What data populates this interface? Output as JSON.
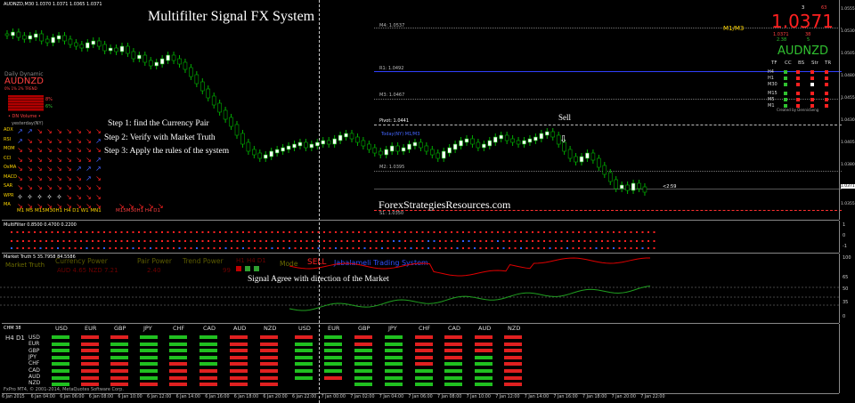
{
  "window": {
    "symbol_info": "AUDNZD,M30 1.0370 1.0371 1.0365 1.0371",
    "title": "Multifilter Signal FX System",
    "watermark": "ForexStrategiesResources.com",
    "copyright": "FxPro MT4, © 2001-2014, MetaQuotes Software Corp."
  },
  "price_box": {
    "price": "1.0371",
    "symbol": "AUDNZD",
    "timeframe": "M1/M3",
    "small_left": "1.0371",
    "small_right": "38",
    "small_val2": "2.38",
    "small_val3": "5",
    "top_num_a": "63",
    "top_num_b": "3",
    "headers": [
      "TF",
      "CC",
      "BS",
      "Str",
      "TR"
    ],
    "rows": [
      "H4",
      "H1",
      "M30",
      "M15",
      "M5",
      "M1"
    ],
    "created_by": "Created by DennisSeng"
  },
  "levels": {
    "r4": "M4: 1.0537",
    "r1": "R1: 1.0492",
    "m3": "M3: 1.0467",
    "pivot": "Pivot: 1.0441",
    "yesterday": "Today(NY) M1/M3",
    "m2": "M2: 1.0395",
    "s1": "S1: 1.0350",
    "timer": "<2:59",
    "sell_label": "Sell"
  },
  "daily_box": {
    "title": "Daily Dynamic",
    "symbol": "AUDNZD",
    "line1": "0% 1% 2% TREND",
    "pct_a": "8%",
    "pct_b": "6%",
    "dn": "• DN Volume •",
    "yesterday": "yesterday(NY)"
  },
  "indicators": {
    "labels": [
      "ADX",
      "RSI",
      "MOM",
      "CCI",
      "OsMA",
      "MACD",
      "SAR",
      "WPR",
      "MA"
    ],
    "timeframes": "M1 M5 M15M30H1 H4 D1 W1 MN1",
    "timeframes2": "M15M30H1 H4 D1"
  },
  "steps": {
    "s1": "Step 1: find the Currency Pair",
    "s2": "Step 2: Verify with Market Truth",
    "s3": "Step 3: Apply the rules of the system"
  },
  "price_scale": [
    "1.0555",
    "1.0530",
    "1.0505",
    "1.0480",
    "1.0455",
    "1.0430",
    "1.0405",
    "1.0380",
    "1.0371",
    "1.0355"
  ],
  "multifilter": {
    "label": "MultiFilter 0.8500 0.4700 0.2200",
    "scale": [
      "1",
      "0",
      "-1"
    ]
  },
  "market_truth": {
    "label": "Market Truth 5 35.7958 84.5586",
    "caption": "Market Truth",
    "currency_power": "Currency Power",
    "pair_power": "Pair Power",
    "trend_power": "Trend Power",
    "tf_labels": "H1 H4 D1",
    "mode_label": "Mode",
    "mode_value": "SELL",
    "system_name": "Jabalameli Trading System",
    "aud_line": "AUD  4.65   NZD  7.21",
    "pp_val": "2.40",
    "tp_val": "99",
    "signal_text": "Signal Agree with direction of the Market",
    "scale": [
      "100",
      "65",
      "50",
      "35",
      "0"
    ]
  },
  "chm": {
    "label": "CHM 38",
    "tf": "H4  D1",
    "currencies": [
      "USD",
      "EUR",
      "GBP",
      "JPY",
      "CHF",
      "CAD",
      "AUD",
      "NZD"
    ],
    "top_currencies": [
      "USD",
      "EUR",
      "GBP",
      "JPY",
      "CHF",
      "CAD",
      "AUD",
      "NZD",
      "USD",
      "EUR",
      "GBP",
      "JPY",
      "CHF",
      "CAD",
      "AUD",
      "NZD"
    ]
  },
  "time_axis": [
    "6 Jan 2015",
    "6 Jan 04:00",
    "6 Jan 06:00",
    "6 Jan 08:00",
    "6 Jan 10:00",
    "6 Jan 12:00",
    "6 Jan 14:00",
    "6 Jan 16:00",
    "6 Jan 18:00",
    "6 Jan 20:00",
    "6 Jan 22:00",
    "7 Jan 00:00",
    "7 Jan 02:00",
    "7 Jan 04:00",
    "7 Jan 06:00",
    "7 Jan 08:00",
    "7 Jan 10:00",
    "7 Jan 12:00",
    "7 Jan 14:00",
    "7 Jan 16:00",
    "7 Jan 18:00",
    "7 Jan 20:00",
    "7 Jan 22:00"
  ],
  "colors": {
    "bull": "#ffffff",
    "bear": "#ffffff",
    "candle_line": "#00c000",
    "red": "#ff2020",
    "green": "#20c020",
    "blue": "#3060ff"
  }
}
